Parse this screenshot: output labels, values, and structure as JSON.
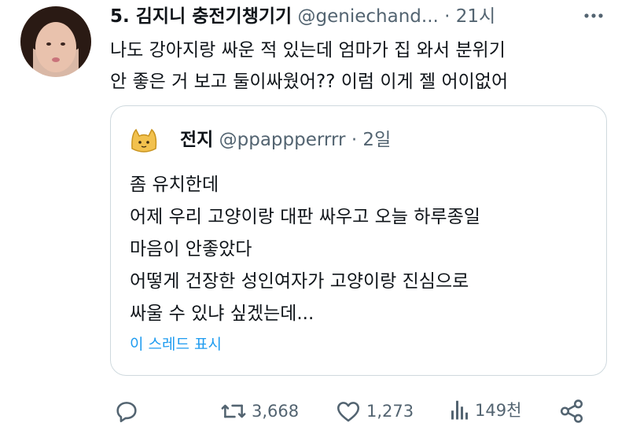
{
  "tweet": {
    "author_name": "5. 김지니 충전기챙기기",
    "handle": "@geniechand...",
    "time": "· 21시",
    "text": "나도 강아지랑 싸운 적 있는데 엄마가 집 와서 분위기\n안 좋은 거 보고 둘이싸웠어?? 이럼 이게 젤 어이없어"
  },
  "quote": {
    "author_name": "전지",
    "handle": "@ppappperrrr",
    "time": "· 2일",
    "text": "좀 유치한데\n어제 우리 고양이랑 대판 싸우고 오늘 하루종일\n마음이 안좋았다\n어떻게 건장한 성인여자가 고양이랑 진심으로\n싸울 수 있냐 싶겠는데...",
    "show_thread": "이 스레드 표시"
  },
  "actions": {
    "reply_icon": "reply-icon",
    "retweet_icon": "retweet-icon",
    "retweet_count": "3,668",
    "like_icon": "heart-icon",
    "like_count": "1,273",
    "views_icon": "views-icon",
    "views_count": "149천",
    "share_icon": "share-icon"
  },
  "colors": {
    "text": "#0f1419",
    "secondary": "#536471",
    "link": "#1d9bf0",
    "border": "#cfd9de"
  }
}
